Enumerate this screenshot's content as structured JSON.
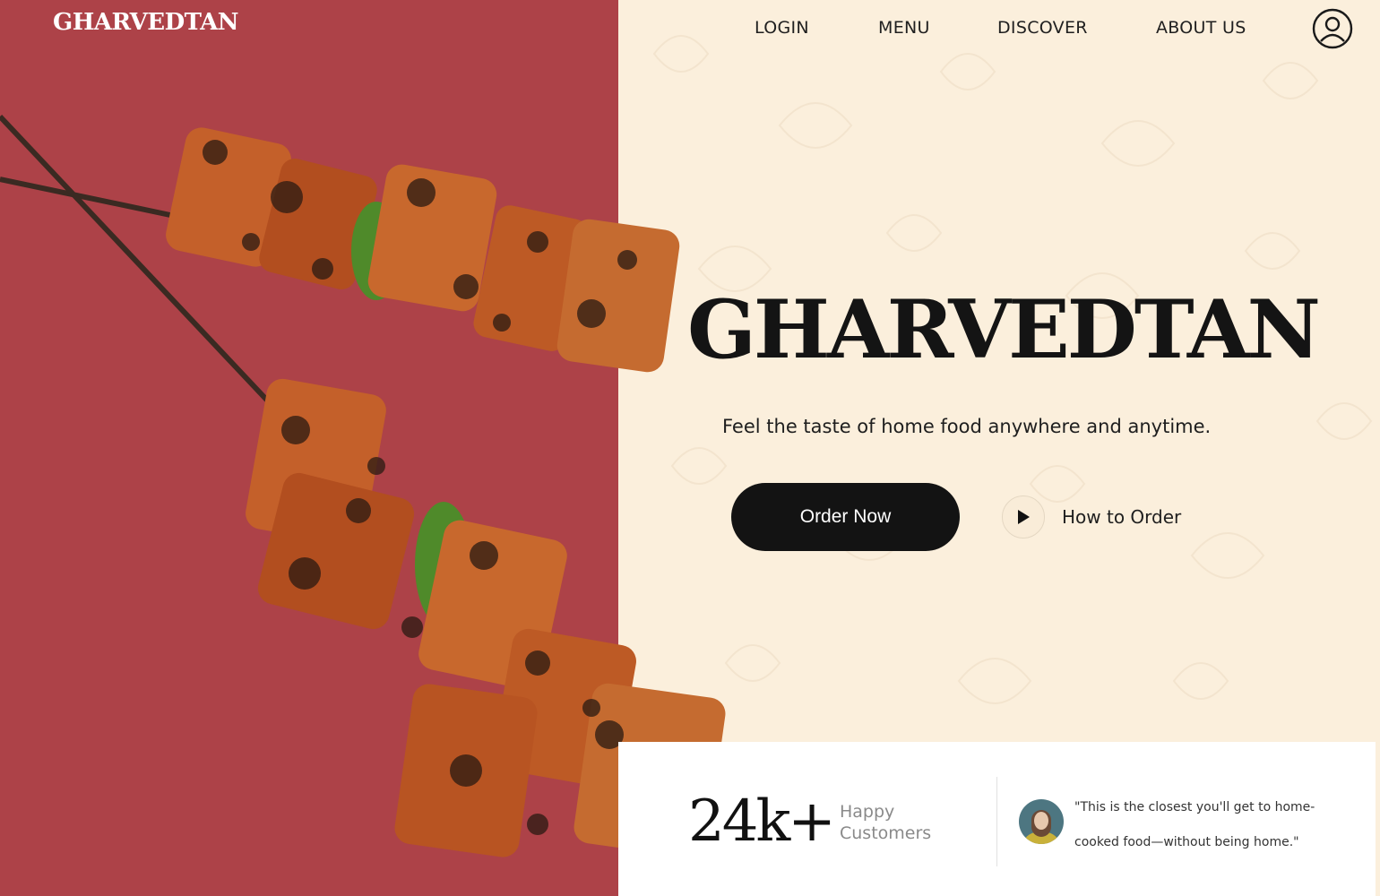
{
  "brand": "GHARVEDTAN",
  "nav": {
    "login": "LOGIN",
    "menu": "MENU",
    "discover": "DISCOVER",
    "about": "ABOUT US"
  },
  "hero": {
    "title": "GHARVEDTAN",
    "tagline": "Feel the taste of home food anywhere and anytime.",
    "order_label": "Order Now",
    "how_label": "How to Order"
  },
  "stats": {
    "number": "24k+",
    "label_line1": "Happy",
    "label_line2": "Customers"
  },
  "testimonial": {
    "quote": "\"This is the closest you'll get to home-cooked food—without being home.\""
  },
  "icons": {
    "user": "user-circle-icon",
    "play": "play-icon"
  },
  "colors": {
    "left_panel": "#ad4248",
    "right_panel": "#fbefdc",
    "button": "#131313"
  }
}
